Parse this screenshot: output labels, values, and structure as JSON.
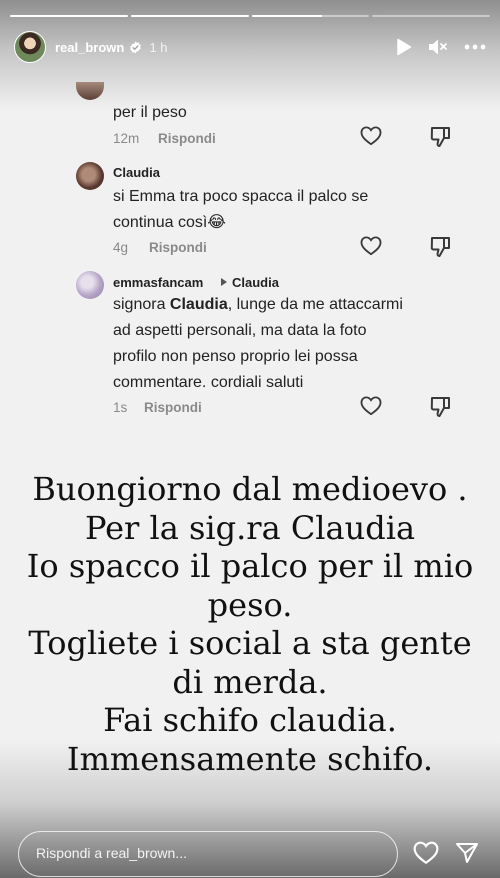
{
  "story": {
    "username": "real_brown",
    "time_ago": "1 h",
    "segments": [
      1,
      1,
      0.6,
      0
    ],
    "comments": [
      {
        "text": "per il peso",
        "age": "12m",
        "reply_label": "Rispondi"
      },
      {
        "name": "Claudia",
        "line1": "si Emma tra poco spacca il palco se",
        "line2": "continua così😂",
        "age": "4g",
        "reply_label": "Rispondi"
      },
      {
        "name": "emmasfancam",
        "reply_to": "Claudia",
        "line1_prefix": "signora ",
        "line1_mention": "Claudia",
        "line1_suffix": ", lunge da me attaccarmi",
        "line2": "ad aspetti personali, ma data la foto",
        "line3": "profilo non penso proprio lei possa",
        "line4": "commentare. cordiali saluti",
        "age": "1s",
        "reply_label": "Rispondi"
      }
    ],
    "caption_lines": [
      "Buongiorno dal medioevo .",
      "Per la sig.ra Claudia",
      "Io spacco il palco per il mio",
      "peso.",
      "Togliete i social a sta gente",
      "di merda.",
      "Fai schifo claudia.",
      "Immensamente schifo."
    ],
    "reply_placeholder": "Rispondi a real_brown..."
  },
  "colors": {
    "verified": "#3897f0",
    "meta_text": "#8a8a8a"
  }
}
